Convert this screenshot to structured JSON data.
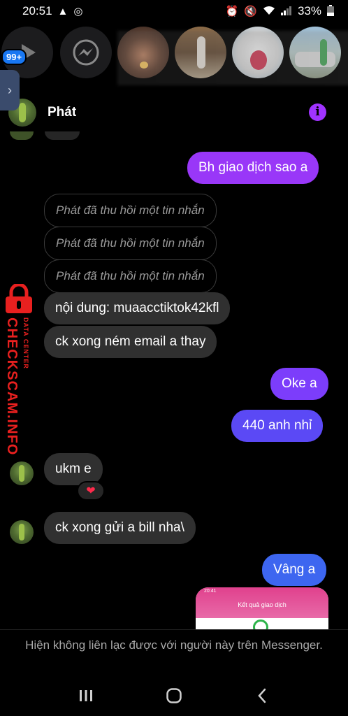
{
  "status_bar": {
    "time": "20:51",
    "battery": "33%",
    "left_icons": [
      "warning-icon",
      "messenger-icon"
    ],
    "right_icons": [
      "alarm-icon",
      "mute-icon",
      "wifi-icon",
      "signal-icon",
      "battery-icon"
    ]
  },
  "stories": {
    "badge": "99+"
  },
  "header": {
    "name": "Phát"
  },
  "messages": [
    {
      "id": "m1",
      "side": "out",
      "text": "Bh giao dịch sao a"
    },
    {
      "id": "m2",
      "side": "in",
      "kind": "recall",
      "text": "Phát đã thu hồi một tin nhắn"
    },
    {
      "id": "m3",
      "side": "in",
      "kind": "recall",
      "text": "Phát đã thu hồi một tin nhắn"
    },
    {
      "id": "m4",
      "side": "in",
      "kind": "recall",
      "text": "Phát đã thu hồi một tin nhắn"
    },
    {
      "id": "m5",
      "side": "in",
      "text": "nội dung: muaacctiktok42kfl"
    },
    {
      "id": "m6",
      "side": "in",
      "text": "ck xong ném email a thay"
    },
    {
      "id": "m7",
      "side": "out",
      "text": "Oke a"
    },
    {
      "id": "m8",
      "side": "out",
      "text": "440 anh nhỉ"
    },
    {
      "id": "m9",
      "side": "in",
      "text": "ukm e",
      "reaction": "❤"
    },
    {
      "id": "m10",
      "side": "in",
      "text": "ck xong gửi a bill nha\\"
    },
    {
      "id": "m11",
      "side": "out",
      "text": "Vâng a"
    }
  ],
  "shared_image": {
    "status_time": "20:41",
    "title": "Kết quả giao dịch"
  },
  "watermark": {
    "main": "CHECKSCAM.INFO",
    "sub": "DATA CENTER"
  },
  "notice": "Hiện không liên lạc được với người này trên Messenger.",
  "colors": {
    "accent_purple": "#9937f8",
    "accent_blue": "#3d66f0",
    "incoming_bubble": "#303030",
    "watermark_red": "#e8201f"
  }
}
